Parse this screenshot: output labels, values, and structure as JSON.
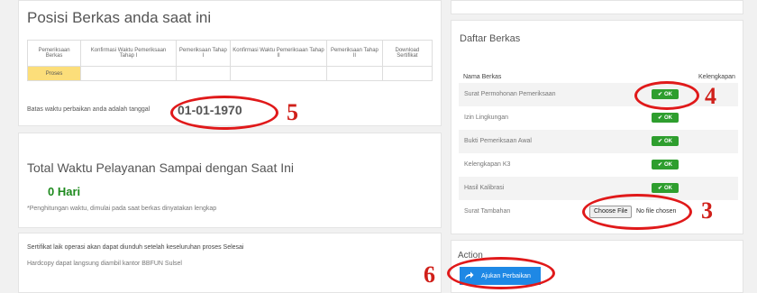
{
  "posisi": {
    "title": "Posisi Berkas anda saat ini",
    "columns": [
      "Pemeriksaan Berkas",
      "Konfirmasi Waktu Pemeriksaan Tahap I",
      "Pemeriksaan Tahap I",
      "Konfirmasi Waktu Pemeriksaan Tahap II",
      "Pemeriksaan Tahap II",
      "Download Sertifikat"
    ],
    "row": [
      "Proses",
      "",
      "",
      "",
      "",
      ""
    ],
    "batas_label": "Batas waktu perbaikan anda adalah tanggal",
    "batas_date": "01-01-1970"
  },
  "total": {
    "title": "Total Waktu Pelayanan Sampai dengan Saat Ini",
    "value": "0 Hari",
    "note": "*Penghitungan waktu, dimulai pada saat berkas dinyatakan lengkap"
  },
  "sertifikat": {
    "line1": "Sertifikat laik operasi akan dapat diunduh setelah keseluruhan proses Selesai",
    "line2": "Hardcopy dapat langsung diambil kantor BBFUN Sulsel"
  },
  "daftar": {
    "title": "Daftar Berkas",
    "col_nama": "Nama Berkas",
    "col_kelengkapan": "Kelengkapan",
    "ok_label": "OK",
    "rows": [
      {
        "name": "Surat Permohonan Pemeriksaan"
      },
      {
        "name": "Izin Lingkungan"
      },
      {
        "name": "Bukti Pemeriksaan Awal"
      },
      {
        "name": "Kelengkapan K3"
      },
      {
        "name": "Hasil Kalibrasi"
      },
      {
        "name": "Surat Tambahan"
      }
    ],
    "choose_file": "Choose File",
    "no_file": "No file chosen"
  },
  "action": {
    "title": "Action",
    "button": "Ajukan Perbaikan"
  },
  "annotations": [
    "5",
    "4",
    "3",
    "6"
  ],
  "colors": {
    "ok_green": "#2e9e2e",
    "highlight_yellow": "#fcde7a",
    "annotation_red": "#e0191a",
    "button_blue": "#1e88e5",
    "hari_green": "#1e8a1e"
  }
}
